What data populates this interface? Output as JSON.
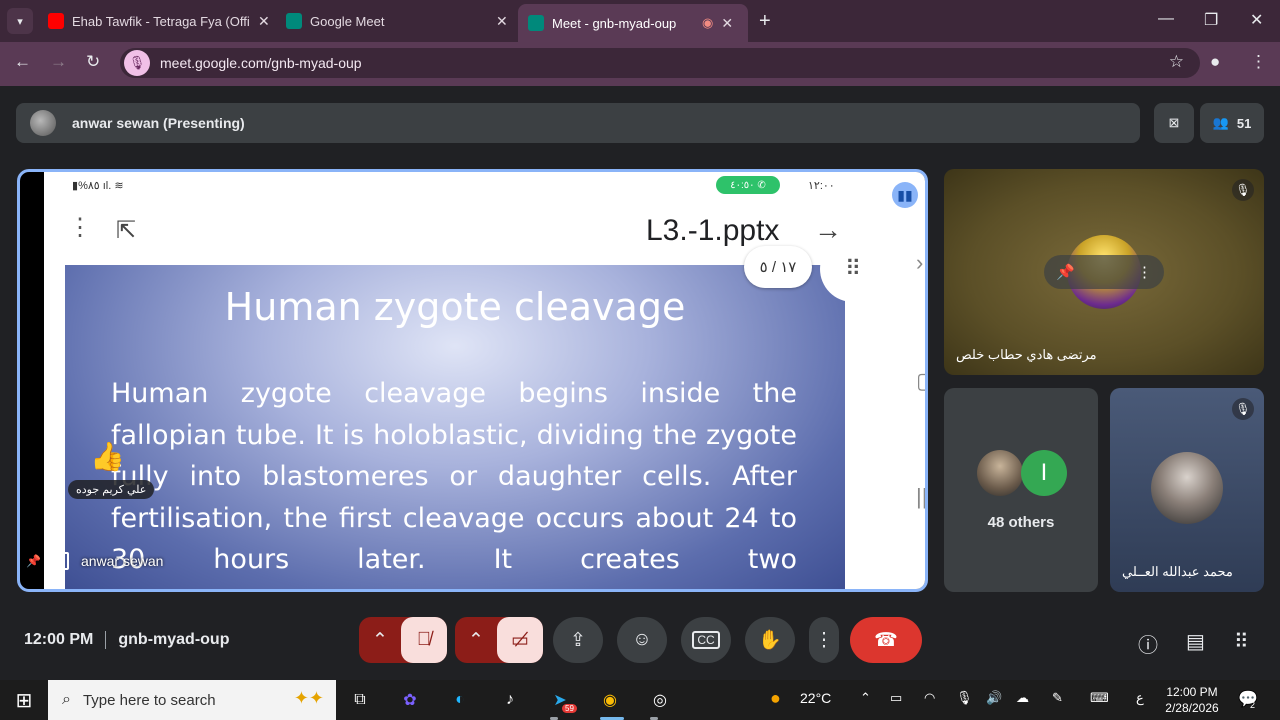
{
  "browser": {
    "tabs": [
      {
        "title": "Ehab Tawfik - Tetraga Fya (Offic",
        "close": "✕",
        "favicon_color": "#ff0000"
      },
      {
        "title": "Google Meet",
        "close": "✕",
        "favicon_color": "#00897b"
      },
      {
        "title": "Meet - gnb-myad-oup",
        "close": "✕",
        "favicon_color": "#00897b"
      }
    ],
    "url": "meet.google.com/gnb-myad-oup"
  },
  "meet": {
    "presenting_label": "anwar sewan (Presenting)",
    "participant_count": "51",
    "presentation": {
      "status_signal": "%٨٥",
      "status_call": "٤٠:٥٠",
      "status_time": "١٢:٠٠",
      "filename": "L3.-1.pptx",
      "page_badge": "١٧ / ٥",
      "slide_title": "Human zygote cleavage",
      "slide_body": "Human zygote cleavage begins inside the fallopian tube. It is holoblastic, dividing the zygote fully into blastomeres or daughter cells. After fertilisation, the first cleavage occurs about 24 to 30 hours later. It creates two",
      "reaction_name": "علي كريم جوده",
      "presenter_name": "anwar sewan"
    },
    "tiles": [
      {
        "name": "مرتضى هادي حطاب خلص"
      },
      {
        "name": "48 others",
        "avatar_letter": "I"
      },
      {
        "name": "محمد عبدالله العــلي"
      }
    ],
    "meeting_time": "12:00 PM",
    "meeting_code": "gnb-myad-oup"
  },
  "taskbar": {
    "search_placeholder": "Type here to search",
    "telegram_badge": "59",
    "weather": "22°C",
    "lang": "ع",
    "time": "12:00 PM",
    "date": "2/28/2026",
    "notif_count": "2"
  },
  "colors": {
    "accent_blue": "#8ab4f8",
    "hangup_red": "#dc362e",
    "muted_red": "#8c1d18"
  }
}
